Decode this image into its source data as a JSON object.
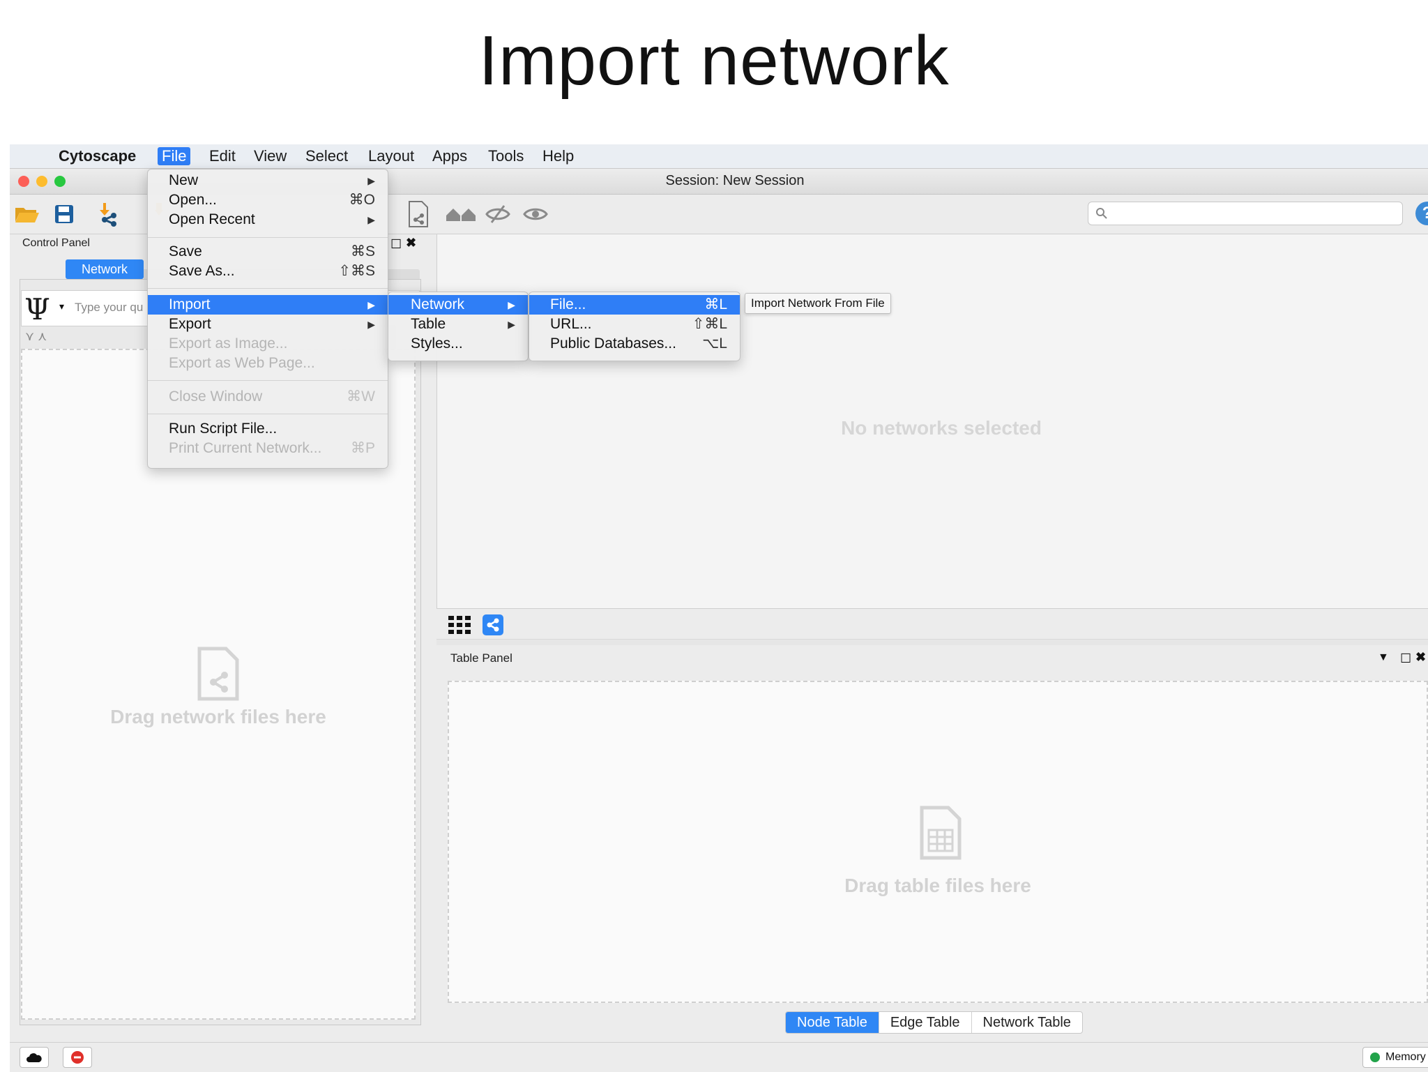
{
  "slide": {
    "title": "Import network"
  },
  "menubar": {
    "app_name": "Cytoscape",
    "items": [
      "File",
      "Edit",
      "View",
      "Select",
      "Layout",
      "Apps",
      "Tools",
      "Help"
    ]
  },
  "window": {
    "title": "Session: New Session"
  },
  "toolbar": {
    "icons": [
      "open-folder-icon",
      "save-icon",
      "import-network-icon",
      "import-table-icon",
      "new-network-icon",
      "show-all-icon",
      "hide-icon",
      "show-icon"
    ],
    "search_placeholder": ""
  },
  "control_panel": {
    "label": "Control Panel",
    "active_tab": "Network",
    "query_placeholder": "Type your qu",
    "drop_text": "Drag network files here"
  },
  "network_view": {
    "empty_text": "No networks selected"
  },
  "table_panel": {
    "label": "Table Panel",
    "drop_text": "Drag table files here",
    "tabs": [
      "Node Table",
      "Edge Table",
      "Network Table"
    ],
    "active_tab": "Node Table"
  },
  "statusbar": {
    "memory_label": "Memory",
    "memory_color": "#22a34a"
  },
  "file_menu": {
    "items": [
      {
        "label": "New",
        "shortcut": "▶"
      },
      {
        "label": "Open...",
        "shortcut": "⌘O"
      },
      {
        "label": "Open Recent",
        "shortcut": "▶"
      },
      {
        "label": "Save",
        "shortcut": "⌘S"
      },
      {
        "label": "Save As...",
        "shortcut": "⇧⌘S"
      },
      {
        "label": "Import",
        "shortcut": "▶"
      },
      {
        "label": "Export",
        "shortcut": "▶"
      },
      {
        "label": "Export as Image...",
        "shortcut": ""
      },
      {
        "label": "Export as Web Page...",
        "shortcut": ""
      },
      {
        "label": "Close Window",
        "shortcut": "⌘W"
      },
      {
        "label": "Run Script File...",
        "shortcut": ""
      },
      {
        "label": "Print Current Network...",
        "shortcut": "⌘P"
      }
    ]
  },
  "import_menu": {
    "items": [
      {
        "label": "Network",
        "shortcut": "▶"
      },
      {
        "label": "Table",
        "shortcut": "▶"
      },
      {
        "label": "Styles...",
        "shortcut": ""
      }
    ]
  },
  "network_menu": {
    "items": [
      {
        "label": "File...",
        "shortcut": "⌘L"
      },
      {
        "label": "URL...",
        "shortcut": "⇧⌘L"
      },
      {
        "label": "Public Databases...",
        "shortcut": "⌥L"
      }
    ]
  },
  "tooltip": "Import Network From File",
  "colors": {
    "accent": "#2f7ef6"
  }
}
